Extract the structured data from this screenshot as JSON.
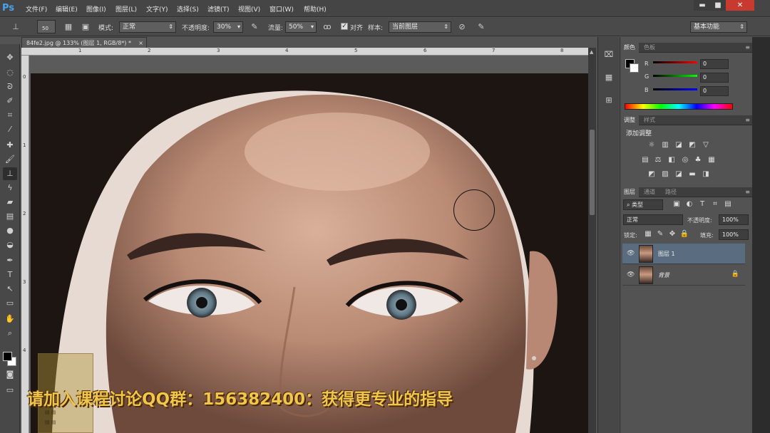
{
  "app": {
    "logo": "Ps"
  },
  "menu": [
    "文件(F)",
    "编辑(E)",
    "图像(I)",
    "图层(L)",
    "文字(Y)",
    "选择(S)",
    "滤镜(T)",
    "视图(V)",
    "窗口(W)",
    "帮助(H)"
  ],
  "window_controls": {
    "minimize": "▬",
    "maximize": "■",
    "close": "✕"
  },
  "options": {
    "brush_size": "50",
    "mode_label": "模式:",
    "mode_value": "正常",
    "opacity_label": "不透明度:",
    "opacity_value": "30%",
    "flow_label": "流量:",
    "flow_value": "50%",
    "aligned_label": "对齐",
    "sample_label": "样本:",
    "sample_value": "当前图层",
    "workspace": "基本功能"
  },
  "document": {
    "tab_title": "84fe2.jpg @ 133% (图层 1, RGB/8*) *",
    "ruler_top": [
      "1",
      "2",
      "3",
      "4",
      "5",
      "6",
      "7",
      "8"
    ],
    "ruler_left": [
      "0",
      "1",
      "2",
      "3",
      "4"
    ]
  },
  "color_panel": {
    "tabs": [
      "颜色",
      "色板"
    ],
    "r_label": "R",
    "g_label": "G",
    "b_label": "B",
    "r": "0",
    "g": "0",
    "b": "0"
  },
  "adjust_panel": {
    "tabs": [
      "调整",
      "样式"
    ],
    "title": "添加调整"
  },
  "layers_panel": {
    "tabs": [
      "图层",
      "通道",
      "路径"
    ],
    "filter": "类型",
    "blend_mode": "正常",
    "opacity_label": "不透明度:",
    "opacity_value": "100%",
    "lock_label": "锁定:",
    "fill_label": "填充:",
    "fill_value": "100%",
    "layers": [
      {
        "name": "图层 1",
        "selected": true
      },
      {
        "name": "背景",
        "selected": false
      }
    ]
  },
  "caption": "请加入课程讨论QQ群：156382400：获得更专业的指导",
  "colors": {
    "accent_selected_layer": "#5a6c80",
    "caption": "#f1c64a",
    "close_button": "#c83a2f"
  }
}
